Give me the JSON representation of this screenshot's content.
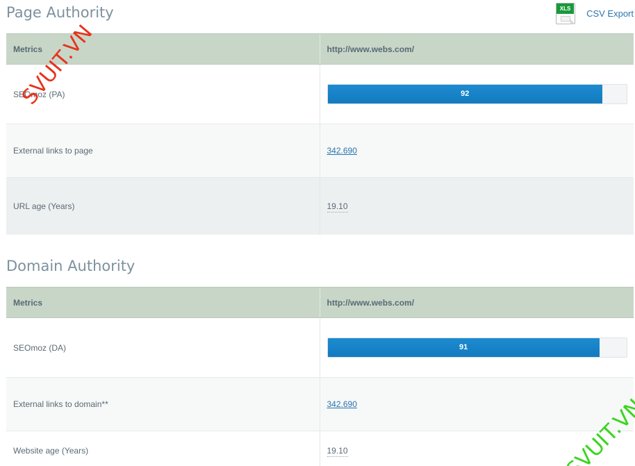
{
  "page_authority": {
    "title": "Page Authority",
    "header": {
      "metrics": "Metrics",
      "url": "http://www.webs.com/"
    },
    "rows": [
      {
        "label": "SEOmoz (PA)",
        "score": 92,
        "score_label": "92",
        "score_max": 100
      },
      {
        "label": "External links to page",
        "value": "342.690"
      },
      {
        "label": "URL age (Years)",
        "value": "19.10"
      }
    ]
  },
  "domain_authority": {
    "title": "Domain Authority",
    "header": {
      "metrics": "Metrics",
      "url": "http://www.webs.com/"
    },
    "rows": [
      {
        "label": "SEOmoz (DA)",
        "score": 91,
        "score_label": "91",
        "score_max": 100
      },
      {
        "label": "External links to domain**",
        "value": "342.690"
      },
      {
        "label": "Website age (Years)",
        "value": "19.10"
      }
    ]
  },
  "export": {
    "icon_badge": "XLS",
    "label": "CSV Export"
  },
  "watermarks": {
    "red": "SVUIT.VN",
    "green": "SVUIT.VN"
  },
  "colors": {
    "bar_fill": "#1683c9",
    "header_bg": "#c8d6c7",
    "link": "#2a74ad"
  }
}
